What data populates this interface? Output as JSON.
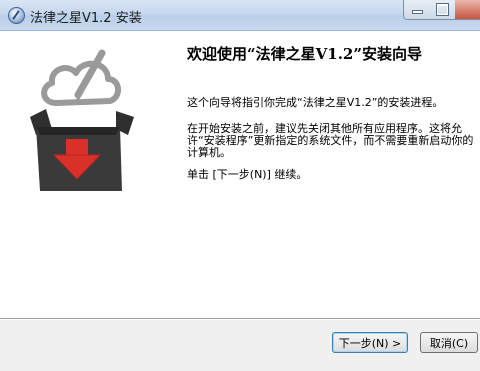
{
  "window": {
    "title": "法律之星V1.2 安装"
  },
  "content": {
    "heading": "欢迎使用“法律之星V1.2”安装向导",
    "para1": "这个向导将指引你完成“法律之星V1.2”的安装进程。",
    "para2": "在开始安装之前，建议先关闭其他所有应用程序。这将允许“安装程序”更新指定的系统文件，而不需要重新启动你的计算机。",
    "para3": "单击 [下一步(N)] 继续。"
  },
  "buttons": {
    "next_label": "下一步(N) >",
    "cancel_label": "取消(C)"
  },
  "colors": {
    "arrow_red": "#d9302a",
    "box_dark": "#3a3a3a",
    "cloud_gray": "#8a8a8a"
  },
  "icons": {
    "app": "installer-app-icon",
    "banner": "installer-box-cloud-icon"
  }
}
